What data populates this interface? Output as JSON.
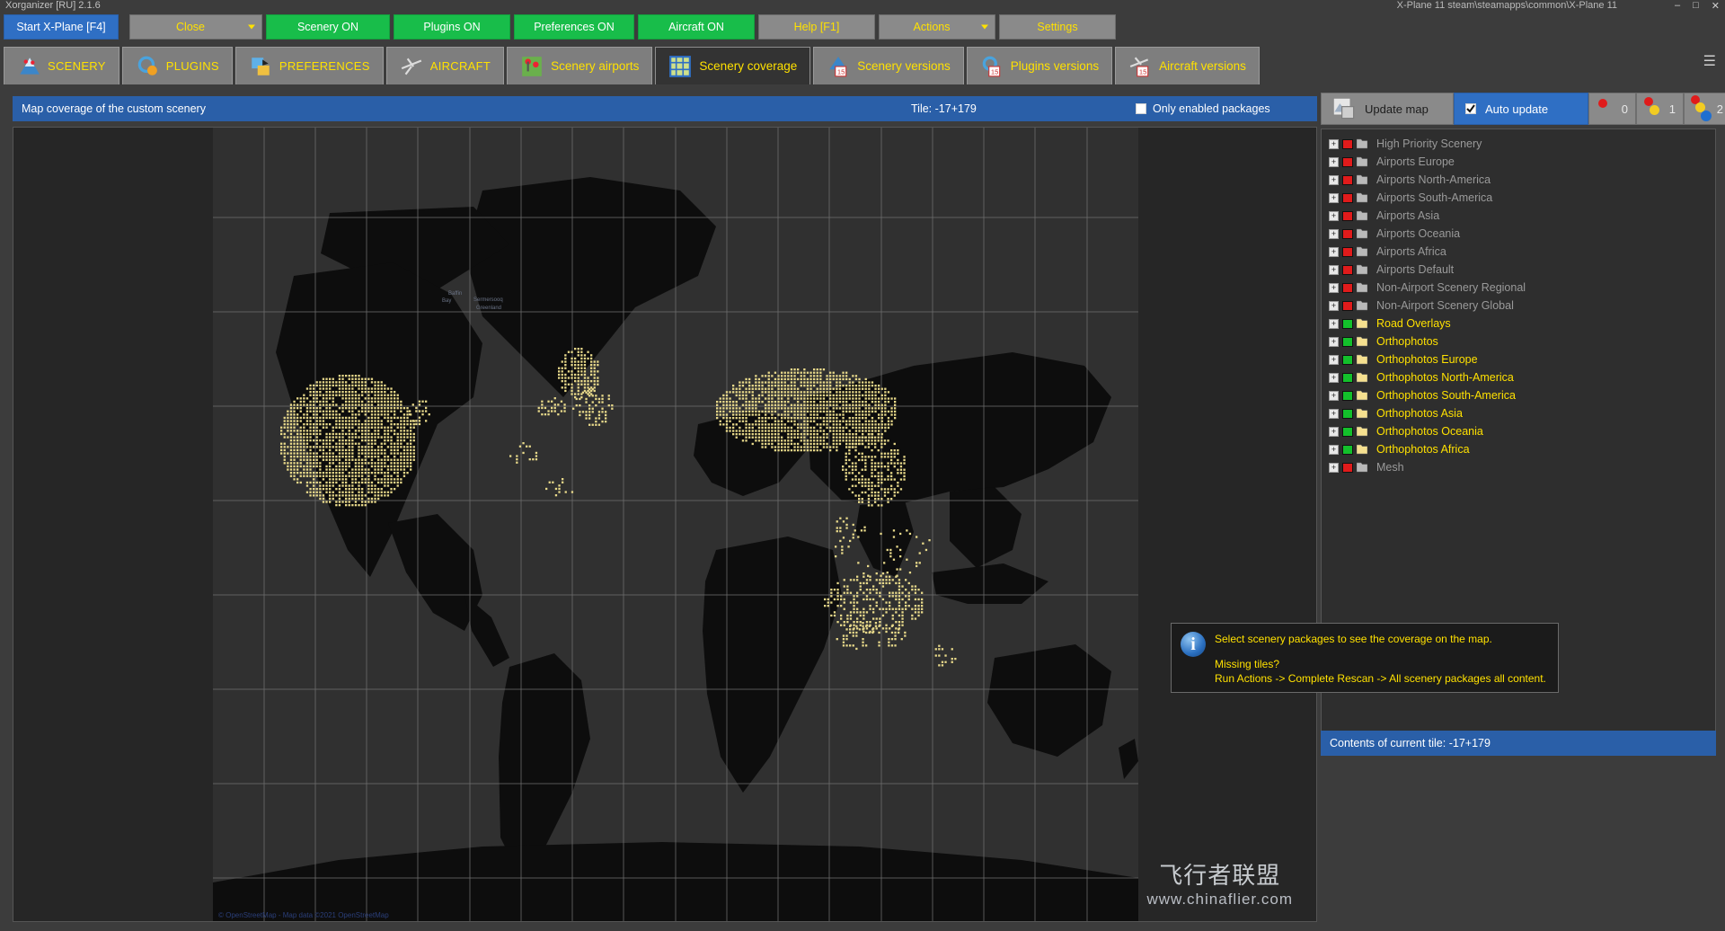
{
  "window": {
    "title": "Xorganizer [RU] 2.1.6",
    "path_hint": "X-Plane 11 steam\\steamapps\\common\\X-Plane 11",
    "controls": [
      "minimize",
      "maximize",
      "close"
    ]
  },
  "toolbar": {
    "start_label": "Start X-Plane [F4]",
    "close_label": "Close",
    "scenery_label": "Scenery ON",
    "plugins_label": "Plugins ON",
    "preferences_label": "Preferences ON",
    "aircraft_label": "Aircraft ON",
    "help_label": "Help [F1]",
    "actions_label": "Actions",
    "settings_label": "Settings"
  },
  "tabs": [
    {
      "label": "SCENERY",
      "icon": "scenery-icon",
      "active": false
    },
    {
      "label": "PLUGINS",
      "icon": "plugins-icon",
      "active": false
    },
    {
      "label": "PREFERENCES",
      "icon": "preferences-icon",
      "active": false
    },
    {
      "label": "AIRCRAFT",
      "icon": "aircraft-icon",
      "active": false
    },
    {
      "label": "Scenery airports",
      "icon": "scenery-airports-icon",
      "active": false
    },
    {
      "label": "Scenery coverage",
      "icon": "scenery-coverage-icon",
      "active": true
    },
    {
      "label": "Scenery versions",
      "icon": "scenery-versions-icon",
      "active": false
    },
    {
      "label": "Plugins versions",
      "icon": "plugins-versions-icon",
      "active": false
    },
    {
      "label": "Aircraft versions",
      "icon": "aircraft-versions-icon",
      "active": false
    }
  ],
  "header": {
    "title": "Map coverage of the custom scenery",
    "tile": "Tile: -17+179",
    "only_enabled_label": "Only enabled packages",
    "only_enabled_checked": false
  },
  "map": {
    "attribution": "© OpenStreetMap - Map data ©2021 OpenStreetMap",
    "watermark_primary": "飞行者联盟",
    "watermark_secondary": "www.chinaflier.com"
  },
  "right_controls": {
    "update_map_label": "Update map",
    "auto_update_label": "Auto update",
    "auto_update_checked": true,
    "counters": [
      {
        "value": "0",
        "dots": [
          "red"
        ]
      },
      {
        "value": "1",
        "dots": [
          "red",
          "yellow"
        ]
      },
      {
        "value": "2",
        "dots": [
          "red",
          "yellow",
          "blue"
        ]
      }
    ]
  },
  "packages": [
    {
      "label": "High Priority Scenery",
      "state": "red",
      "folder": "grey",
      "enabled": false
    },
    {
      "label": "Airports Europe",
      "state": "red",
      "folder": "grey",
      "enabled": false
    },
    {
      "label": "Airports North-America",
      "state": "red",
      "folder": "grey",
      "enabled": false
    },
    {
      "label": "Airports South-America",
      "state": "red",
      "folder": "grey",
      "enabled": false
    },
    {
      "label": "Airports Asia",
      "state": "red",
      "folder": "grey",
      "enabled": false
    },
    {
      "label": "Airports Oceania",
      "state": "red",
      "folder": "grey",
      "enabled": false
    },
    {
      "label": "Airports Africa",
      "state": "red",
      "folder": "grey",
      "enabled": false
    },
    {
      "label": "Airports Default",
      "state": "red",
      "folder": "grey",
      "enabled": false
    },
    {
      "label": "Non-Airport Scenery Regional",
      "state": "red",
      "folder": "grey",
      "enabled": false
    },
    {
      "label": "Non-Airport Scenery Global",
      "state": "red",
      "folder": "grey",
      "enabled": false
    },
    {
      "label": "Road Overlays",
      "state": "green",
      "folder": "yellow",
      "enabled": true
    },
    {
      "label": "Orthophotos",
      "state": "green",
      "folder": "yellow",
      "enabled": true
    },
    {
      "label": "Orthophotos Europe",
      "state": "green",
      "folder": "yellow",
      "enabled": true
    },
    {
      "label": "Orthophotos North-America",
      "state": "green",
      "folder": "yellow",
      "enabled": true
    },
    {
      "label": "Orthophotos South-America",
      "state": "green",
      "folder": "yellow",
      "enabled": true
    },
    {
      "label": "Orthophotos Asia",
      "state": "green",
      "folder": "yellow",
      "enabled": true
    },
    {
      "label": "Orthophotos Oceania",
      "state": "green",
      "folder": "yellow",
      "enabled": true
    },
    {
      "label": "Orthophotos Africa",
      "state": "green",
      "folder": "yellow",
      "enabled": true
    },
    {
      "label": "Mesh",
      "state": "red",
      "folder": "grey",
      "enabled": false
    }
  ],
  "info_box": {
    "line1": "Select scenery packages to see the coverage on the map.",
    "line2": "Missing tiles?",
    "line3": "Run Actions -> Complete Rescan -> All scenery packages all content."
  },
  "contents_bar": {
    "label": "Contents of current tile: -17+179"
  },
  "colors": {
    "accent_blue": "#2a5fa8",
    "button_green": "#18bd4a",
    "button_grey": "#8a8a8a",
    "text_yellow": "#ffe100",
    "state_red": "#e01b1b",
    "state_green": "#13c02b",
    "tile_yellow": "#e8d98a"
  }
}
